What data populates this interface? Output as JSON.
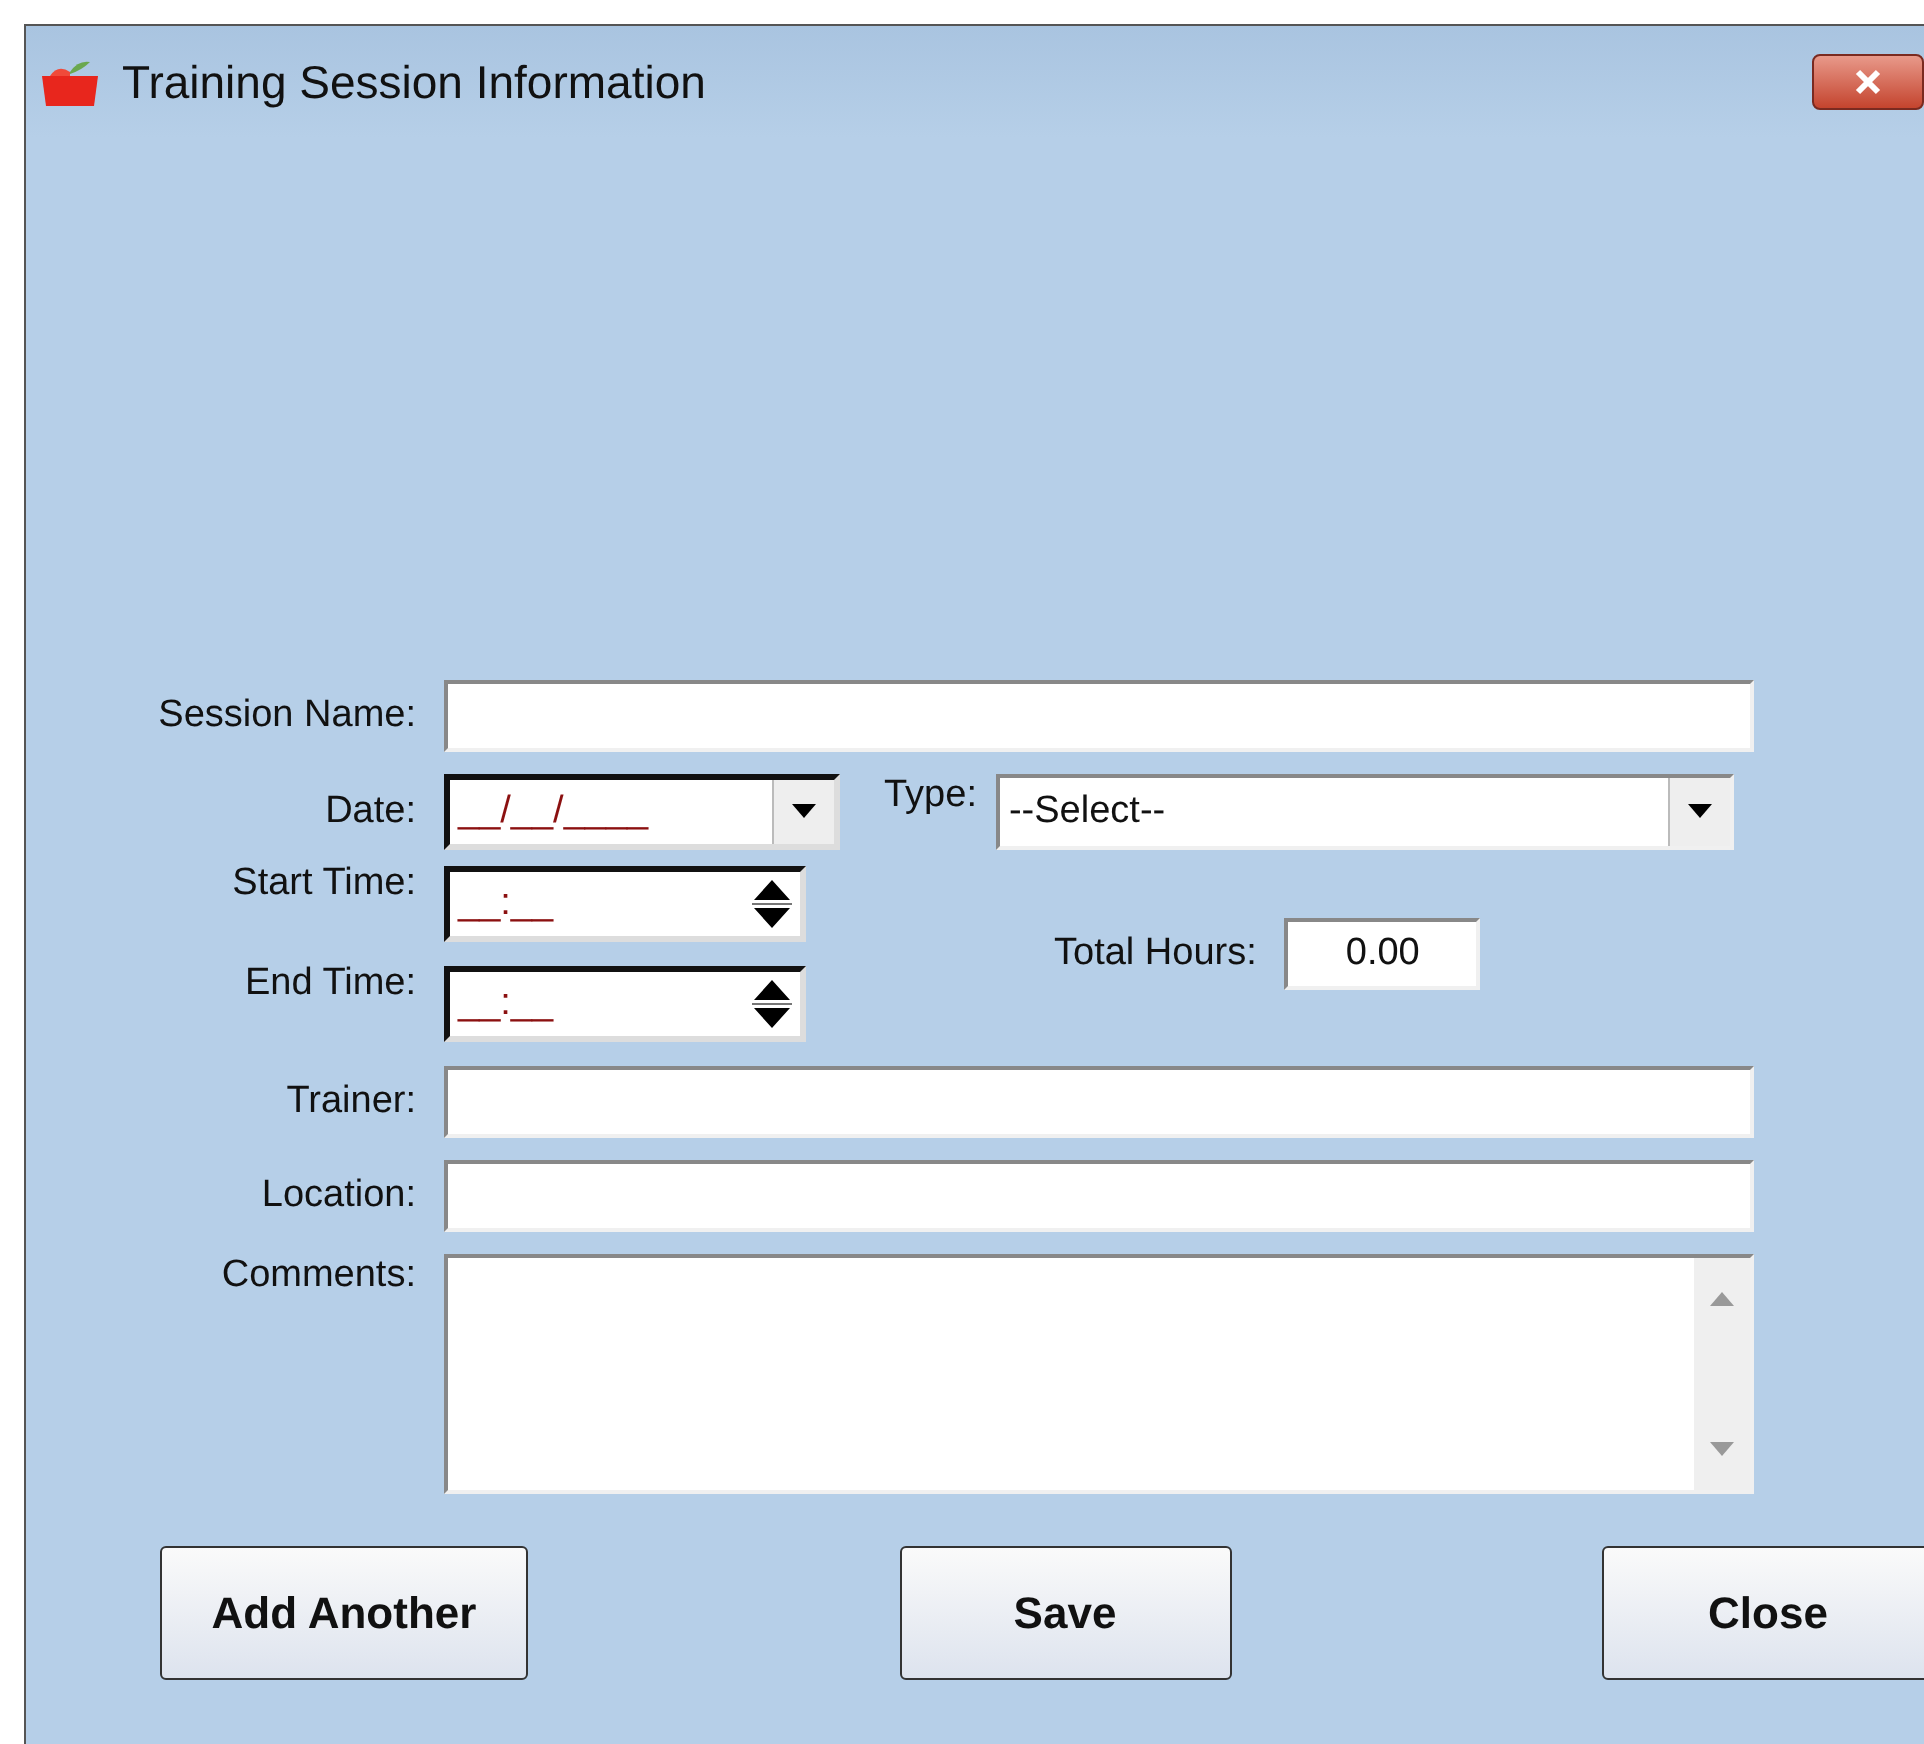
{
  "window": {
    "title": "Training Session Information"
  },
  "form": {
    "session_name": {
      "label": "Session Name:"
    },
    "date": {
      "label": "Date:",
      "placeholder": "__/__/____"
    },
    "type": {
      "label": "Type:",
      "value": "--Select--"
    },
    "start_time": {
      "label": "Start Time:",
      "placeholder": "__:__"
    },
    "end_time": {
      "label": "End Time:",
      "placeholder": "__:__"
    },
    "total_hours": {
      "label": "Total Hours:",
      "value": "0.00"
    },
    "trainer": {
      "label": "Trainer:"
    },
    "location": {
      "label": "Location:"
    },
    "comments": {
      "label": "Comments:"
    }
  },
  "buttons": [
    "Add Another",
    "Save",
    "Close"
  ]
}
